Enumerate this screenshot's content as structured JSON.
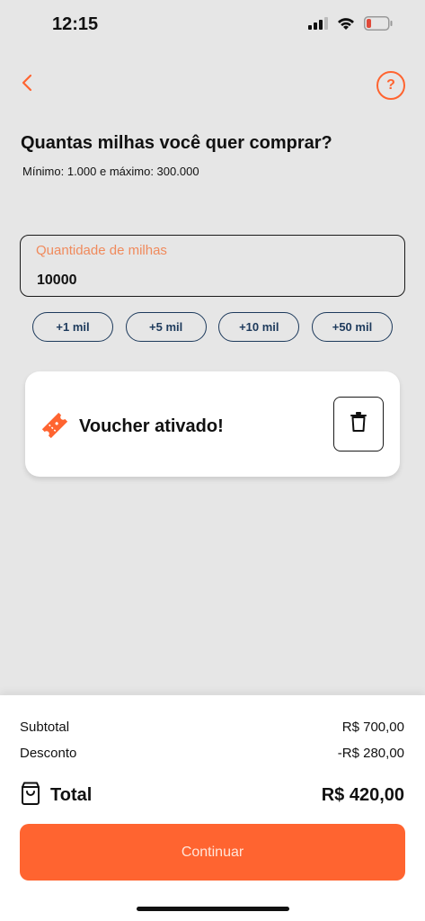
{
  "status_bar": {
    "time": "12:15",
    "icons": [
      "signal-icon",
      "wifi-icon",
      "battery-icon"
    ],
    "battery_color": "#e04a3a"
  },
  "header": {
    "back_icon": "chevron-left-icon",
    "help_label": "?"
  },
  "page": {
    "title": "Quantas milhas você quer comprar?",
    "subtitle": "Mínimo: 1.000 e máximo: 300.000"
  },
  "quantity_field": {
    "label": "Quantidade de milhas",
    "value": "10000"
  },
  "chips": [
    {
      "label": "+1 mil"
    },
    {
      "label": "+5 mil"
    },
    {
      "label": "+10 mil"
    },
    {
      "label": "+50 mil"
    }
  ],
  "voucher": {
    "icon": "ticket-icon",
    "text": "Voucher ativado!",
    "remove_icon": "trash-icon"
  },
  "summary": {
    "subtotal_label": "Subtotal",
    "subtotal_value": "R$ 700,00",
    "discount_label": "Desconto",
    "discount_value": "-R$ 280,00",
    "total_icon": "shopping-bag-icon",
    "total_label": "Total",
    "total_value": "R$ 420,00"
  },
  "actions": {
    "continue_label": "Continuar"
  },
  "colors": {
    "accent": "#ff6430",
    "chip_border": "#1d3a5c",
    "background": "#e6e6e6"
  }
}
